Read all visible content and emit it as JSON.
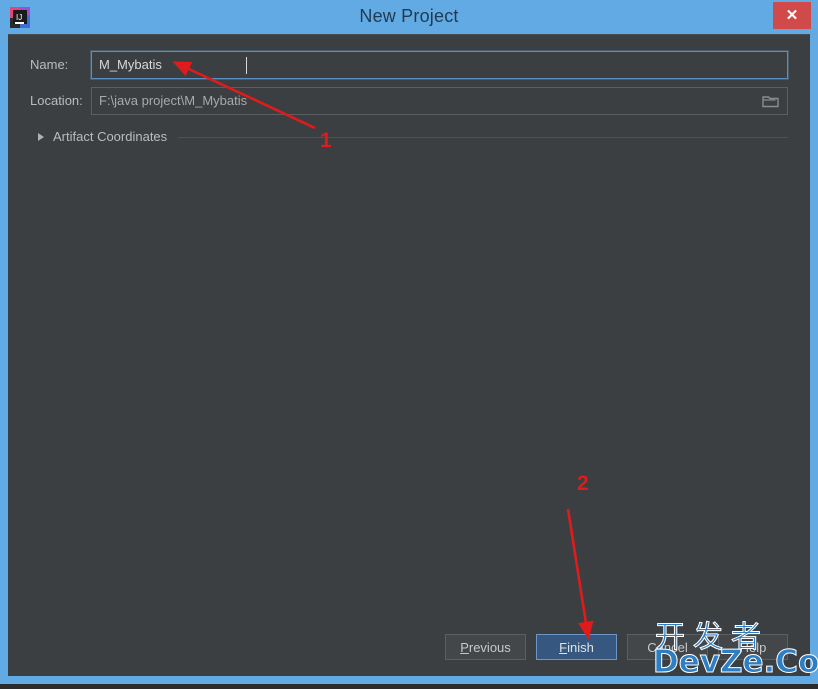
{
  "window": {
    "title": "New Project",
    "app_icon": "intellij-idea-icon",
    "close_label": "✕",
    "frame_color": "#62aae4",
    "body_color": "#3c3f41"
  },
  "form": {
    "name": {
      "label": "Name:",
      "value": "M_Mybatis",
      "placeholder": "",
      "focused": true
    },
    "location": {
      "label": "Location:",
      "value": "F:\\java project\\M_Mybatis",
      "placeholder": "",
      "browse_icon": "folder-icon"
    },
    "artifact_coordinates": {
      "label": "Artifact Coordinates",
      "expanded": false,
      "chevron_icon": "triangle-right-icon"
    }
  },
  "buttons": {
    "previous": {
      "mnemonic": "P",
      "rest": "revious"
    },
    "finish": {
      "mnemonic": "F",
      "rest": "inish",
      "default": true,
      "accent": "#365880"
    },
    "cancel": {
      "label": "Cancel"
    },
    "help": {
      "label": "Help"
    }
  },
  "annotations": {
    "color": "#e01b1b",
    "items": [
      {
        "number": "1",
        "points_to": "name-input"
      },
      {
        "number": "2",
        "points_to": "finish-button"
      }
    ]
  },
  "watermark": {
    "cn": "开发者",
    "en": "DevZe.CoM",
    "color": "#2e7ec4"
  }
}
